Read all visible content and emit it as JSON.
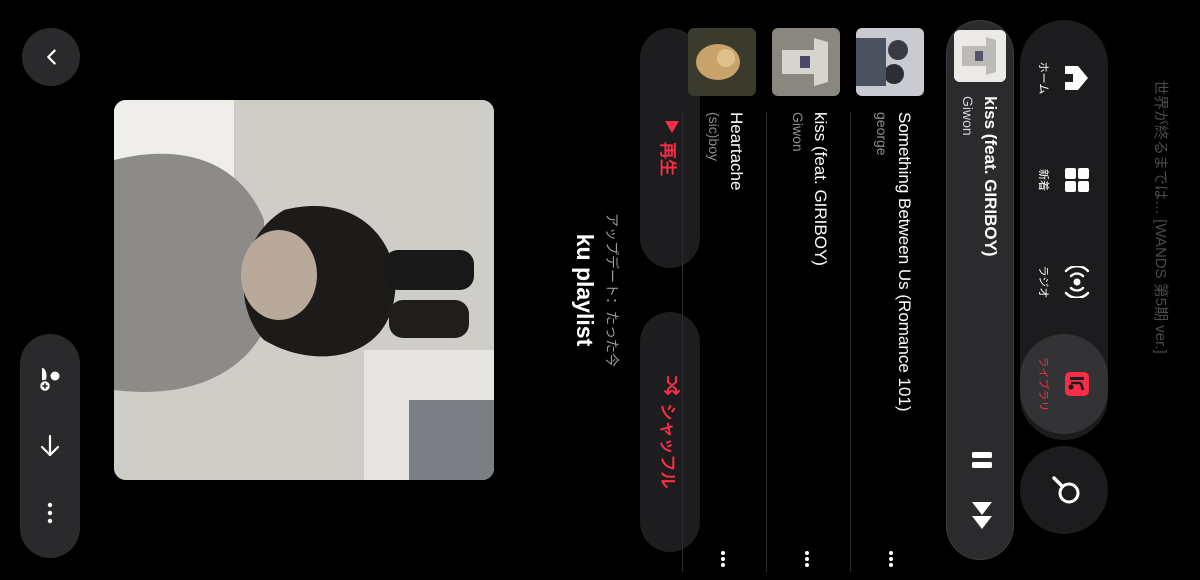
{
  "toolbar": {
    "back_icon": "chevron-down-icon",
    "actions": [
      "add-collaborator-icon",
      "arrow-forward-icon",
      "more-icon"
    ]
  },
  "playlist": {
    "title": "ku playlist",
    "updated": "アップデート：たった今",
    "play_label": "再生",
    "shuffle_label": "シャッフル"
  },
  "songs": [
    {
      "title": "Heartache",
      "artist": "(sic)boy"
    },
    {
      "title": "kiss (feat. GIRIBOY)",
      "artist": "Giwon"
    },
    {
      "title": "Something Between Us (Romance 101)",
      "artist": "george"
    }
  ],
  "now_playing": {
    "title": "kiss (feat. GIRIBOY)",
    "artist": "Giwon"
  },
  "tabs": [
    {
      "label": "ホーム",
      "icon": "home-icon",
      "active": false
    },
    {
      "label": "新着",
      "icon": "grid-icon",
      "active": false
    },
    {
      "label": "ラジオ",
      "icon": "radio-icon",
      "active": false
    },
    {
      "label": "ライブラリ",
      "icon": "library-icon",
      "active": true
    }
  ],
  "search_icon": "search-icon",
  "background_text": "世界が終るまでは… [WANDS 第5期 ver.]",
  "colors": {
    "accent": "#fa2d48",
    "background": "#000000",
    "surface": "#1c1c1e"
  }
}
